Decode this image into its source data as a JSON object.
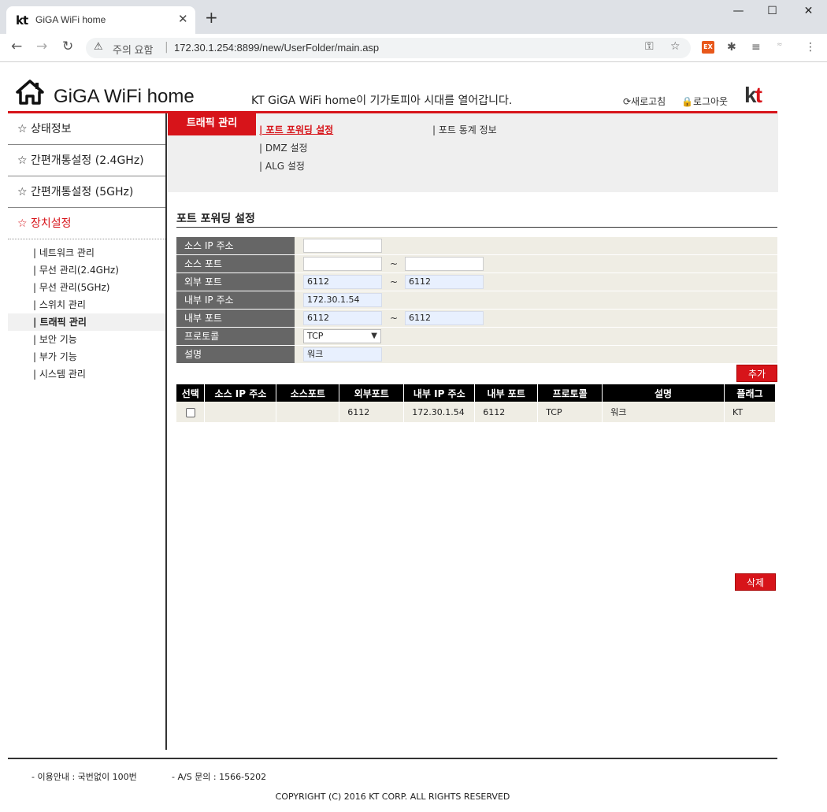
{
  "browser": {
    "tab_favicon": "kt",
    "tab_title": "GiGA WiFi home",
    "tab_close": "✕",
    "new_tab": "+",
    "security_text": "주의 요함",
    "url": "172.30.1.254:8899/new/UserFolder/main.asp",
    "window_controls": [
      "—",
      "☐",
      "✕"
    ]
  },
  "header": {
    "title": "GiGA WiFi home",
    "slogan": "KT GiGA WiFi home이 기가토피아 시대를 열어갑니다.",
    "refresh": "⟳새로고침",
    "logout": "🔒로그아웃",
    "logo_k": "k",
    "logo_t": "t"
  },
  "sidebar": {
    "main": [
      {
        "label": "☆ 상태정보"
      },
      {
        "label": "☆ 간편개통설정 (2.4GHz)"
      },
      {
        "label": "☆ 간편개통설정 (5GHz)"
      },
      {
        "label": "☆ 장치설정"
      }
    ],
    "sub": [
      {
        "label": "| 네트워크 관리"
      },
      {
        "label": "| 무선 관리(2.4GHz)"
      },
      {
        "label": "| 무선 관리(5GHz)"
      },
      {
        "label": "| 스위치 관리"
      },
      {
        "label": "| 트래픽 관리"
      },
      {
        "label": "| 보안 기능"
      },
      {
        "label": "| 부가 기능"
      },
      {
        "label": "| 시스템 관리"
      }
    ]
  },
  "submenu": {
    "tab_label": "트래픽 관리",
    "links": [
      {
        "label": "| 포트 포워딩 설정"
      },
      {
        "label": "| 포트 통계 정보"
      },
      {
        "label": "| DMZ 설정"
      },
      {
        "label": "| ALG 설정"
      }
    ]
  },
  "section": {
    "title": "포트 포워딩 설정"
  },
  "form": {
    "source_ip_label": "소스 IP 주소",
    "source_port_label": "소스 포트",
    "external_port_label": "외부 포트",
    "external_port_from": "6112",
    "external_port_to": "6112",
    "internal_ip_label": "내부 IP 주소",
    "internal_ip": "172.30.1.54",
    "internal_port_label": "내부 포트",
    "internal_port_from": "6112",
    "internal_port_to": "6112",
    "protocol_label": "프로토콜",
    "protocol_value": "TCP",
    "description_label": "설명",
    "description_value": "워크",
    "tilde": "~",
    "add_button": "추가"
  },
  "table": {
    "headers": [
      "선택",
      "소스 IP 주소",
      "소스포트",
      "외부포트",
      "내부 IP 주소",
      "내부 포트",
      "프로토콜",
      "설명",
      "플래그"
    ],
    "rows": [
      {
        "source_ip": "",
        "source_port": "",
        "external_port": "6112",
        "internal_ip": "172.30.1.54",
        "internal_port": "6112",
        "protocol": "TCP",
        "description": "워크",
        "flag": "KT"
      }
    ],
    "delete_button": "삭제"
  },
  "footer": {
    "usage": "- 이용안내 : 국번없이 100번",
    "as_inquiry": "- A/S 문의 : 1566-5202",
    "copyright": "COPYRIGHT (C) 2016 KT CORP. ALL RIGHTS RESERVED"
  },
  "colors": {
    "accent": "#d7141a",
    "label_bg": "#666666",
    "cell_bg": "#efede4"
  }
}
